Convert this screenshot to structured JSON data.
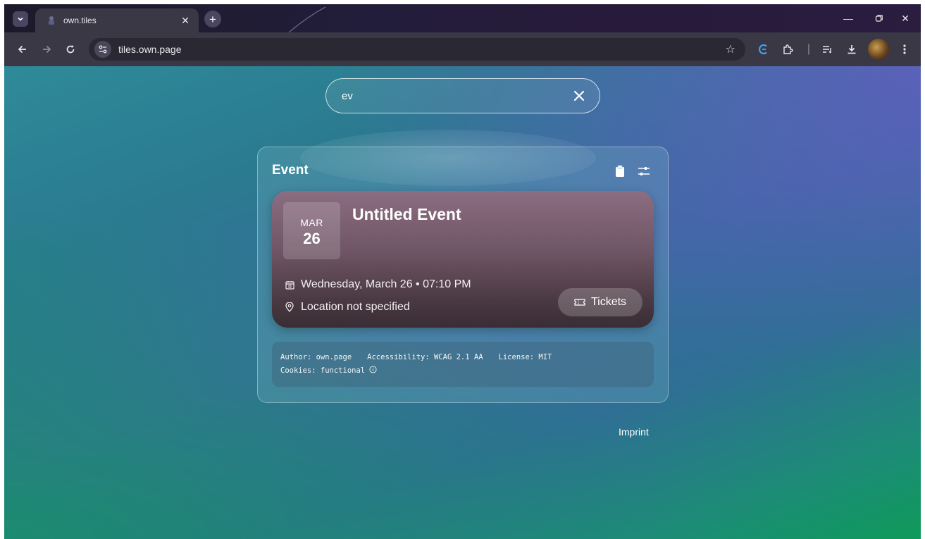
{
  "browser": {
    "tab_title": "own.tiles",
    "url": "tiles.own.page"
  },
  "search": {
    "value": "ev"
  },
  "panel": {
    "title": "Event"
  },
  "event": {
    "month": "MAR",
    "day": "26",
    "title": "Untitled Event",
    "datetime": "Wednesday, March 26 • 07:10 PM",
    "location": "Location not specified",
    "tickets_label": "Tickets"
  },
  "meta": {
    "author": "Author: own.page",
    "accessibility": "Accessibility: WCAG 2.1 AA",
    "license": "License: MIT",
    "cookies": "Cookies: functional"
  },
  "footer": {
    "imprint": "Imprint"
  },
  "colors": {
    "card_top": "#8c6d82",
    "card_bottom": "#3a2d34",
    "chrome_toolbar": "#3a3845",
    "accent_blue": "#3fa0f0"
  }
}
